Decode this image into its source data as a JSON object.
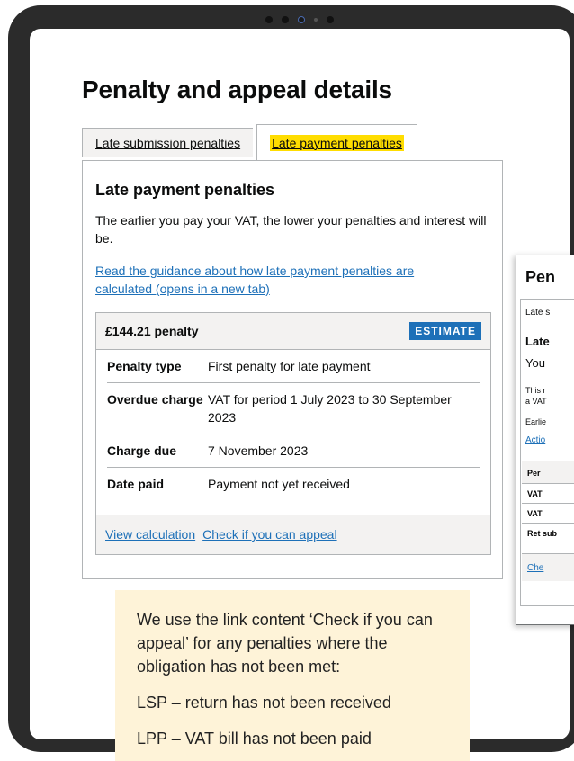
{
  "page": {
    "title": "Penalty and appeal details",
    "tabs": [
      {
        "label": "Late submission penalties",
        "active": false
      },
      {
        "label": "Late payment penalties",
        "active": true
      }
    ],
    "panel": {
      "heading": "Late payment penalties",
      "intro": "The earlier you pay your VAT, the lower your penalties and interest will be.",
      "guidance_link": "Read the guidance about how late payment penalties are calculated (opens in a new tab)"
    },
    "penalty_card": {
      "title": "£144.21 penalty",
      "badge": "ESTIMATE",
      "rows": [
        {
          "key": "Penalty type",
          "value": "First penalty for late payment"
        },
        {
          "key": "Overdue charge",
          "value": "VAT for period 1 July 2023 to 30 September 2023"
        },
        {
          "key": "Charge due",
          "value": "7 November 2023"
        },
        {
          "key": "Date paid",
          "value": "Payment not yet received"
        }
      ],
      "actions": [
        "View calculation",
        "Check if you can appeal"
      ]
    }
  },
  "note": {
    "lines": [
      "We use the link content ‘Check if you can appeal’ for any penalties where the obligation has not been met:",
      "LSP – return has not been received",
      "LPP – VAT bill has not been paid"
    ]
  },
  "preview": {
    "title": "Pen",
    "tab": "Late s",
    "subheading": "Late",
    "text": "You",
    "small_lines": [
      "This r",
      "a VAT"
    ],
    "small2": "Earlie",
    "link": "Actio",
    "table_header": "Per",
    "rows": [
      "VAT",
      "VAT",
      "Ret sub"
    ],
    "footer_link": "Che"
  }
}
